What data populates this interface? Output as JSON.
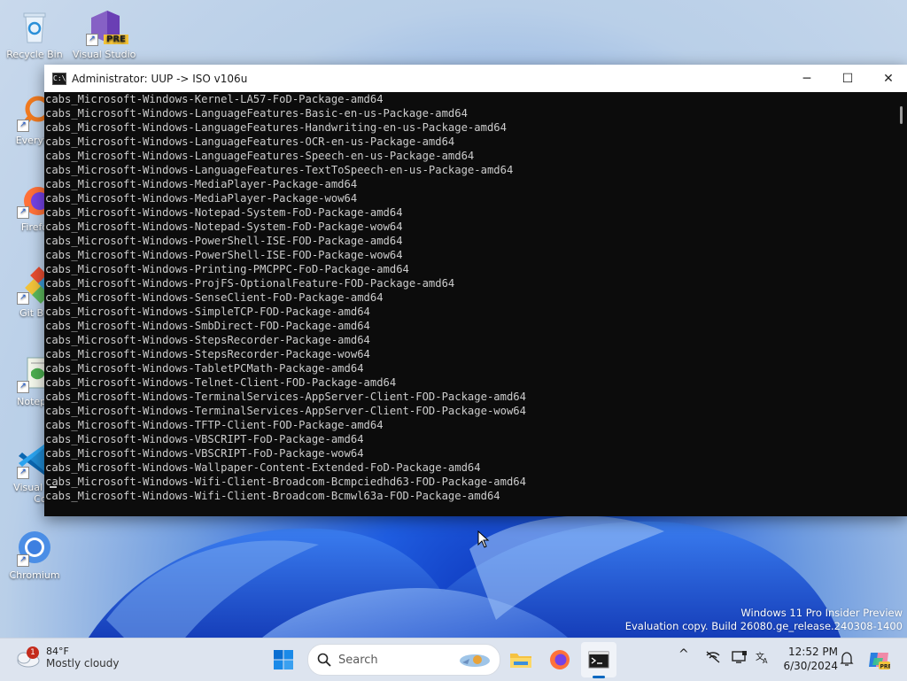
{
  "desktop": {
    "icons": [
      {
        "label": "Recycle Bin",
        "icon": "recycle-bin-icon"
      },
      {
        "label": "Visual Studio",
        "icon": "visual-studio-icon",
        "badge": "PRE"
      },
      {
        "label": "Everyth",
        "icon": "everything-icon"
      },
      {
        "label": "Firefo",
        "icon": "firefox-icon"
      },
      {
        "label": "Git Ba",
        "icon": "git-bash-icon"
      },
      {
        "label": "Notepa",
        "icon": "notepad-icon"
      },
      {
        "label": "Visual St",
        "label2": "Cod",
        "icon": "vscode-icon"
      },
      {
        "label": "Chromium",
        "icon": "chromium-icon"
      }
    ],
    "watermark": {
      "line1": "Windows 11 Pro Insider Preview",
      "line2": "Evaluation copy. Build 26080.ge_release.240308-1400"
    }
  },
  "window": {
    "title": "Administrator:  UUP -> ISO v106u",
    "minimize": "─",
    "maximize": "☐",
    "close": "✕",
    "lines": [
      "cabs_Microsoft-Windows-Kernel-LA57-FoD-Package-amd64",
      "cabs_Microsoft-Windows-LanguageFeatures-Basic-en-us-Package-amd64",
      "cabs_Microsoft-Windows-LanguageFeatures-Handwriting-en-us-Package-amd64",
      "cabs_Microsoft-Windows-LanguageFeatures-OCR-en-us-Package-amd64",
      "cabs_Microsoft-Windows-LanguageFeatures-Speech-en-us-Package-amd64",
      "cabs_Microsoft-Windows-LanguageFeatures-TextToSpeech-en-us-Package-amd64",
      "cabs_Microsoft-Windows-MediaPlayer-Package-amd64",
      "cabs_Microsoft-Windows-MediaPlayer-Package-wow64",
      "cabs_Microsoft-Windows-Notepad-System-FoD-Package-amd64",
      "cabs_Microsoft-Windows-Notepad-System-FoD-Package-wow64",
      "cabs_Microsoft-Windows-PowerShell-ISE-FOD-Package-amd64",
      "cabs_Microsoft-Windows-PowerShell-ISE-FOD-Package-wow64",
      "cabs_Microsoft-Windows-Printing-PMCPPC-FoD-Package-amd64",
      "cabs_Microsoft-Windows-ProjFS-OptionalFeature-FOD-Package-amd64",
      "cabs_Microsoft-Windows-SenseClient-FoD-Package-amd64",
      "cabs_Microsoft-Windows-SimpleTCP-FOD-Package-amd64",
      "cabs_Microsoft-Windows-SmbDirect-FOD-Package-amd64",
      "cabs_Microsoft-Windows-StepsRecorder-Package-amd64",
      "cabs_Microsoft-Windows-StepsRecorder-Package-wow64",
      "cabs_Microsoft-Windows-TabletPCMath-Package-amd64",
      "cabs_Microsoft-Windows-Telnet-Client-FOD-Package-amd64",
      "cabs_Microsoft-Windows-TerminalServices-AppServer-Client-FOD-Package-amd64",
      "cabs_Microsoft-Windows-TerminalServices-AppServer-Client-FOD-Package-wow64",
      "cabs_Microsoft-Windows-TFTP-Client-FOD-Package-amd64",
      "cabs_Microsoft-Windows-VBSCRIPT-FoD-Package-amd64",
      "cabs_Microsoft-Windows-VBSCRIPT-FoD-Package-wow64",
      "cabs_Microsoft-Windows-Wallpaper-Content-Extended-FoD-Package-amd64",
      "cabs_Microsoft-Windows-Wifi-Client-Broadcom-Bcmpciedhd63-FOD-Package-amd64",
      "cabs_Microsoft-Windows-Wifi-Client-Broadcom-Bcmwl63a-FOD-Package-amd64"
    ]
  },
  "taskbar": {
    "weather": {
      "temp": "84°F",
      "condition": "Mostly cloudy",
      "badge": "1"
    },
    "search_placeholder": "Search",
    "clock": {
      "time": "12:52 PM",
      "date": "6/30/2024"
    },
    "tray_chevron": "^",
    "colors": {
      "accent": "#0067c0",
      "console_bg": "#0c0c0c",
      "console_fg": "#cccccc"
    }
  }
}
